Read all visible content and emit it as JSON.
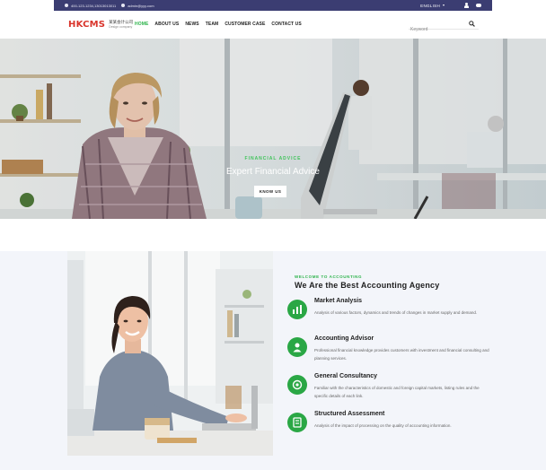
{
  "topbar": {
    "phone": "400-123-1234,13013013011",
    "email": "admin@yyy.com",
    "language": "ENGLISH",
    "user_icon": "user-icon",
    "chat_icon": "wechat-icon"
  },
  "header": {
    "logo_text": "HKCMS",
    "logo_cn": "某某会计公司",
    "logo_en": "Design company",
    "nav": [
      {
        "label": "HOME",
        "active": true
      },
      {
        "label": "ABOUT US"
      },
      {
        "label": "NEWS"
      },
      {
        "label": "TEAM"
      },
      {
        "label": "CUSTOMER CASE"
      },
      {
        "label": "CONTACT US"
      }
    ],
    "search_placeholder": "Keyword",
    "search_icon": "search-icon"
  },
  "hero": {
    "kicker": "FINANCIAL ADVICE",
    "title": "Expert Financial Advice",
    "button_label": "KNOW US"
  },
  "about": {
    "kicker": "WELCOME TO ACCOUNTING",
    "title": "We Are the Best Accounting Agency",
    "features": [
      {
        "title": "Market Analysis",
        "desc": "Analysis of various factors, dynamics and trends of changes in market supply and demand.",
        "icon": "chart-icon"
      },
      {
        "title": "Accounting Advisor",
        "desc": "Professional financial knowledge provides customers with investment and financial consulting and planning services.",
        "icon": "advisor-icon"
      },
      {
        "title": "General Consultancy",
        "desc": "Familiar with the characteristics of domestic and foreign capital markets, listing rules and the specific details of each link.",
        "icon": "consultancy-icon"
      },
      {
        "title": "Structured Assessment",
        "desc": "Analysis of the impact of processing on the quality of accounting information.",
        "icon": "assessment-icon"
      }
    ]
  },
  "colors": {
    "topbar": "#3b3d72",
    "accent_green": "#2aa745",
    "logo_red": "#d9342b"
  }
}
